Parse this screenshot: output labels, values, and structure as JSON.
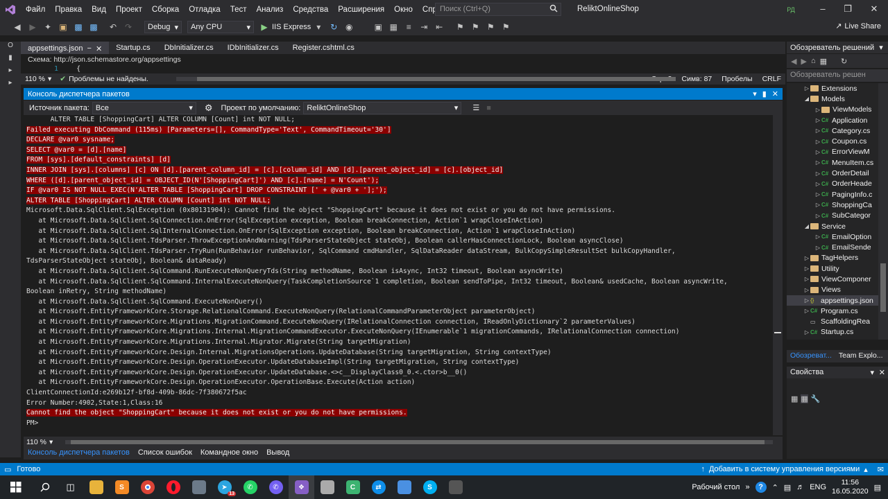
{
  "menubar": {
    "items": [
      "Файл",
      "Правка",
      "Вид",
      "Проект",
      "Сборка",
      "Отладка",
      "Тест",
      "Анализ",
      "Средства",
      "Расширения",
      "Окно",
      "Справка"
    ],
    "search_placeholder": "Поиск (Ctrl+Q)",
    "solution_title": "ReliktOnlineShop",
    "avatar_initials": "РД"
  },
  "toolbar": {
    "config": "Debug",
    "platform": "Any CPU",
    "run_target": "IIS Express",
    "live_share": "Live Share"
  },
  "doc_tabs": [
    "appsettings.json",
    "Startup.cs",
    "DbInitializer.cs",
    "IDbInitializer.cs",
    "Register.cshtml.cs"
  ],
  "editor": {
    "schema_label": "Схема:",
    "schema_url": "http://json.schemastore.org/appsettings",
    "line_number": "1",
    "line_text": "{",
    "zoom": "110 %",
    "problems": "Проблемы не найдены.",
    "line": "Стр: 3",
    "col": "Симв: 87",
    "whitespace": "Пробелы",
    "eol": "CRLF"
  },
  "pmc": {
    "title": "Консоль диспетчера пакетов",
    "source_label": "Источник пакета:",
    "source_value": "Все",
    "default_project_label": "Проект по умолчанию:",
    "default_project_value": "ReliktOnlineShop",
    "zoom": "110 %",
    "lines": [
      {
        "text": "      ALTER TABLE [ShoppingCart] ALTER COLUMN [Count] int NOT NULL;",
        "err": false
      },
      {
        "text": "Failed executing DbCommand (115ms) [Parameters=[], CommandType='Text', CommandTimeout='30']",
        "err": true
      },
      {
        "text": "DECLARE @var0 sysname;",
        "err": true
      },
      {
        "text": "SELECT @var0 = [d].[name]",
        "err": true
      },
      {
        "text": "FROM [sys].[default_constraints] [d]",
        "err": true
      },
      {
        "text": "INNER JOIN [sys].[columns] [c] ON [d].[parent_column_id] = [c].[column_id] AND [d].[parent_object_id] = [c].[object_id]",
        "err": true
      },
      {
        "text": "WHERE ([d].[parent_object_id] = OBJECT_ID(N'[ShoppingCart]') AND [c].[name] = N'Count');",
        "err": true
      },
      {
        "text": "IF @var0 IS NOT NULL EXEC(N'ALTER TABLE [ShoppingCart] DROP CONSTRAINT [' + @var0 + '];');",
        "err": true
      },
      {
        "text": "ALTER TABLE [ShoppingCart] ALTER COLUMN [Count] int NOT NULL;",
        "err": true
      },
      {
        "text": "Microsoft.Data.SqlClient.SqlException (0x80131904): Cannot find the object \"ShoppingCart\" because it does not exist or you do not have permissions.",
        "err": false
      },
      {
        "text": "   at Microsoft.Data.SqlClient.SqlConnection.OnError(SqlException exception, Boolean breakConnection, Action`1 wrapCloseInAction)",
        "err": false
      },
      {
        "text": "   at Microsoft.Data.SqlClient.SqlInternalConnection.OnError(SqlException exception, Boolean breakConnection, Action`1 wrapCloseInAction)",
        "err": false
      },
      {
        "text": "   at Microsoft.Data.SqlClient.TdsParser.ThrowExceptionAndWarning(TdsParserStateObject stateObj, Boolean callerHasConnectionLock, Boolean asyncClose)",
        "err": false
      },
      {
        "text": "   at Microsoft.Data.SqlClient.TdsParser.TryRun(RunBehavior runBehavior, SqlCommand cmdHandler, SqlDataReader dataStream, BulkCopySimpleResultSet bulkCopyHandler,",
        "err": false
      },
      {
        "text": "TdsParserStateObject stateObj, Boolean& dataReady)",
        "err": false
      },
      {
        "text": "   at Microsoft.Data.SqlClient.SqlCommand.RunExecuteNonQueryTds(String methodName, Boolean isAsync, Int32 timeout, Boolean asyncWrite)",
        "err": false
      },
      {
        "text": "   at Microsoft.Data.SqlClient.SqlCommand.InternalExecuteNonQuery(TaskCompletionSource`1 completion, Boolean sendToPipe, Int32 timeout, Boolean& usedCache, Boolean asyncWrite,",
        "err": false
      },
      {
        "text": "Boolean inRetry, String methodName)",
        "err": false
      },
      {
        "text": "   at Microsoft.Data.SqlClient.SqlCommand.ExecuteNonQuery()",
        "err": false
      },
      {
        "text": "   at Microsoft.EntityFrameworkCore.Storage.RelationalCommand.ExecuteNonQuery(RelationalCommandParameterObject parameterObject)",
        "err": false
      },
      {
        "text": "   at Microsoft.EntityFrameworkCore.Migrations.MigrationCommand.ExecuteNonQuery(IRelationalConnection connection, IReadOnlyDictionary`2 parameterValues)",
        "err": false
      },
      {
        "text": "   at Microsoft.EntityFrameworkCore.Migrations.Internal.MigrationCommandExecutor.ExecuteNonQuery(IEnumerable`1 migrationCommands, IRelationalConnection connection)",
        "err": false
      },
      {
        "text": "   at Microsoft.EntityFrameworkCore.Migrations.Internal.Migrator.Migrate(String targetMigration)",
        "err": false
      },
      {
        "text": "   at Microsoft.EntityFrameworkCore.Design.Internal.MigrationsOperations.UpdateDatabase(String targetMigration, String contextType)",
        "err": false
      },
      {
        "text": "   at Microsoft.EntityFrameworkCore.Design.OperationExecutor.UpdateDatabaseImpl(String targetMigration, String contextType)",
        "err": false
      },
      {
        "text": "   at Microsoft.EntityFrameworkCore.Design.OperationExecutor.UpdateDatabase.<>c__DisplayClass0_0.<.ctor>b__0()",
        "err": false
      },
      {
        "text": "   at Microsoft.EntityFrameworkCore.Design.OperationExecutor.OperationBase.Execute(Action action)",
        "err": false
      },
      {
        "text": "ClientConnectionId:e269b12f-bf8d-409b-86dc-7f380672f5ac",
        "err": false
      },
      {
        "text": "Error Number:4902,State:1,Class:16",
        "err": false
      },
      {
        "text": "Cannot find the object \"ShoppingCart\" because it does not exist or you do not have permissions.",
        "err": true
      },
      {
        "text": "PM>",
        "err": false
      }
    ]
  },
  "bottom_tabs": [
    "Консоль диспетчера пакетов",
    "Список ошибок",
    "Командное окно",
    "Вывод"
  ],
  "statusbar": {
    "ready": "Готово",
    "source_control": "Добавить в систему управления версиями"
  },
  "solution_explorer": {
    "title": "Обозреватель решений",
    "search_placeholder": "Обозреватель решен",
    "items": [
      {
        "label": "Extensions",
        "kind": "folder",
        "indent": 1,
        "chev": "▷"
      },
      {
        "label": "Models",
        "kind": "folder",
        "indent": 1,
        "chev": "◢"
      },
      {
        "label": "ViewModels",
        "kind": "folder",
        "indent": 2,
        "chev": "▷"
      },
      {
        "label": "Application",
        "kind": "cs",
        "indent": 2,
        "chev": "▷"
      },
      {
        "label": "Category.cs",
        "kind": "cs",
        "indent": 2,
        "chev": "▷"
      },
      {
        "label": "Coupon.cs",
        "kind": "cs",
        "indent": 2,
        "chev": "▷"
      },
      {
        "label": "ErrorViewM",
        "kind": "cs",
        "indent": 2,
        "chev": "▷"
      },
      {
        "label": "MenuItem.cs",
        "kind": "cs",
        "indent": 2,
        "chev": "▷"
      },
      {
        "label": "OrderDetail",
        "kind": "cs",
        "indent": 2,
        "chev": "▷"
      },
      {
        "label": "OrderHeade",
        "kind": "cs",
        "indent": 2,
        "chev": "▷"
      },
      {
        "label": "PagingInfo.c",
        "kind": "cs",
        "indent": 2,
        "chev": "▷"
      },
      {
        "label": "ShoppingCa",
        "kind": "cs",
        "indent": 2,
        "chev": "▷"
      },
      {
        "label": "SubCategor",
        "kind": "cs",
        "indent": 2,
        "chev": "▷"
      },
      {
        "label": "Service",
        "kind": "folder",
        "indent": 1,
        "chev": "◢"
      },
      {
        "label": "EmailOption",
        "kind": "cs",
        "indent": 2,
        "chev": "▷"
      },
      {
        "label": "EmailSende",
        "kind": "cs",
        "indent": 2,
        "chev": "▷"
      },
      {
        "label": "TagHelpers",
        "kind": "folder",
        "indent": 1,
        "chev": "▷"
      },
      {
        "label": "Utility",
        "kind": "folder",
        "indent": 1,
        "chev": "▷"
      },
      {
        "label": "ViewComponer",
        "kind": "folder",
        "indent": 1,
        "chev": "▷"
      },
      {
        "label": "Views",
        "kind": "folder",
        "indent": 1,
        "chev": "▷"
      },
      {
        "label": "appsettings.json",
        "kind": "json",
        "indent": 1,
        "chev": "▷",
        "selected": true
      },
      {
        "label": "Program.cs",
        "kind": "cs",
        "indent": 1,
        "chev": "▷"
      },
      {
        "label": "ScaffoldingRea",
        "kind": "txt",
        "indent": 1,
        "chev": ""
      },
      {
        "label": "Startup.cs",
        "kind": "cs",
        "indent": 1,
        "chev": "▷"
      }
    ],
    "tabs": [
      "Обозреват...",
      "Team Explo..."
    ]
  },
  "properties": {
    "title": "Свойства"
  },
  "taskbar": {
    "desktop_label": "Рабочий стол",
    "lang": "ENG",
    "time": "11:56",
    "date": "16.05.2020",
    "telegram_badge": "13"
  }
}
